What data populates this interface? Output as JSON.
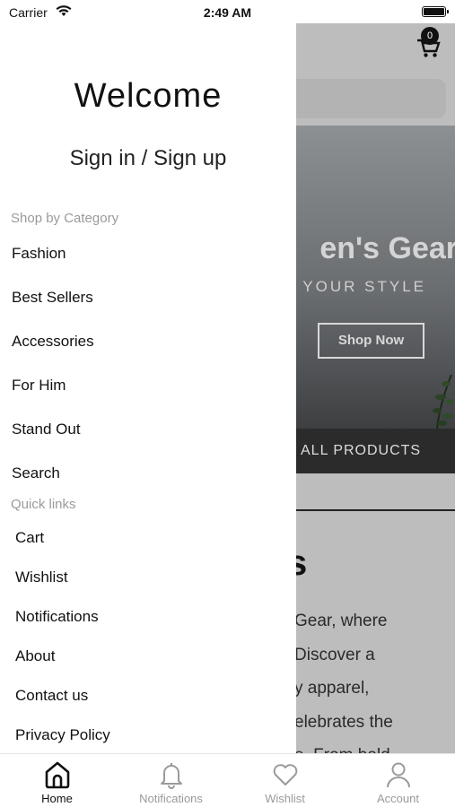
{
  "status_bar": {
    "carrier": "Carrier",
    "time": "2:49 AM"
  },
  "background_screen": {
    "cart_count": "0",
    "hero_title": "en's Gear",
    "hero_subtitle": "YOUR STYLE",
    "hero_button": "Shop Now",
    "all_products": "ALL PRODUCTS",
    "about_heading": "s",
    "about_lines": [
      "Gear, where",
      "Discover a",
      "y apparel,",
      "elebrates the",
      "e. From bold"
    ]
  },
  "drawer": {
    "welcome": "Welcome",
    "sign_in": "Sign in / Sign up",
    "categories_label": "Shop by Category",
    "categories": [
      "Fashion",
      "Best Sellers",
      "Accessories",
      "For Him",
      "Stand Out",
      "Search"
    ],
    "quick_links_label": "Quick links",
    "quick_links": [
      "Cart",
      "Wishlist",
      "Notifications",
      "About",
      "Contact us",
      "Privacy Policy"
    ]
  },
  "tab_bar": {
    "tabs": [
      {
        "label": "Home",
        "icon": "home-icon",
        "active": true
      },
      {
        "label": "Notifications",
        "icon": "bell-icon",
        "active": false
      },
      {
        "label": "Wishlist",
        "icon": "heart-icon",
        "active": false
      },
      {
        "label": "Account",
        "icon": "person-icon",
        "active": false
      }
    ]
  },
  "colors": {
    "accent": "#111111",
    "muted": "#9a9a9a",
    "overlay": "#bdbdbd"
  }
}
